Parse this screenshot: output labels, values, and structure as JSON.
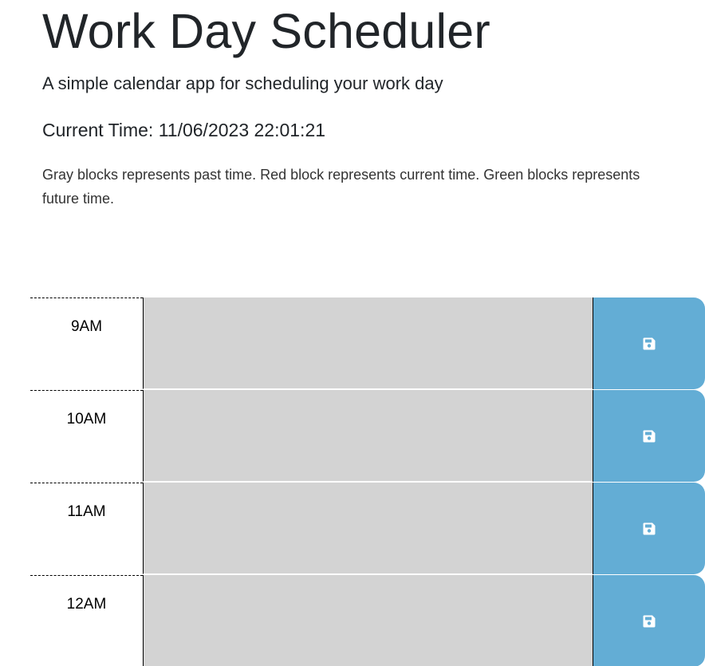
{
  "header": {
    "title": "Work Day Scheduler",
    "subtitle": "A simple calendar app for scheduling your work day",
    "current_time": "Current Time: 11/06/2023 22:01:21",
    "legend": "Gray blocks represents past time. Red block represents current time. Green blocks represents future time."
  },
  "colors": {
    "past": "#d3d3d3",
    "save_button": "#63add5"
  },
  "time_blocks": [
    {
      "hour": "9AM",
      "description": "",
      "state": "past",
      "save_icon": "save-icon"
    },
    {
      "hour": "10AM",
      "description": "",
      "state": "past",
      "save_icon": "save-icon"
    },
    {
      "hour": "11AM",
      "description": "",
      "state": "past",
      "save_icon": "save-icon"
    },
    {
      "hour": "12AM",
      "description": "",
      "state": "past",
      "save_icon": "save-icon"
    }
  ]
}
